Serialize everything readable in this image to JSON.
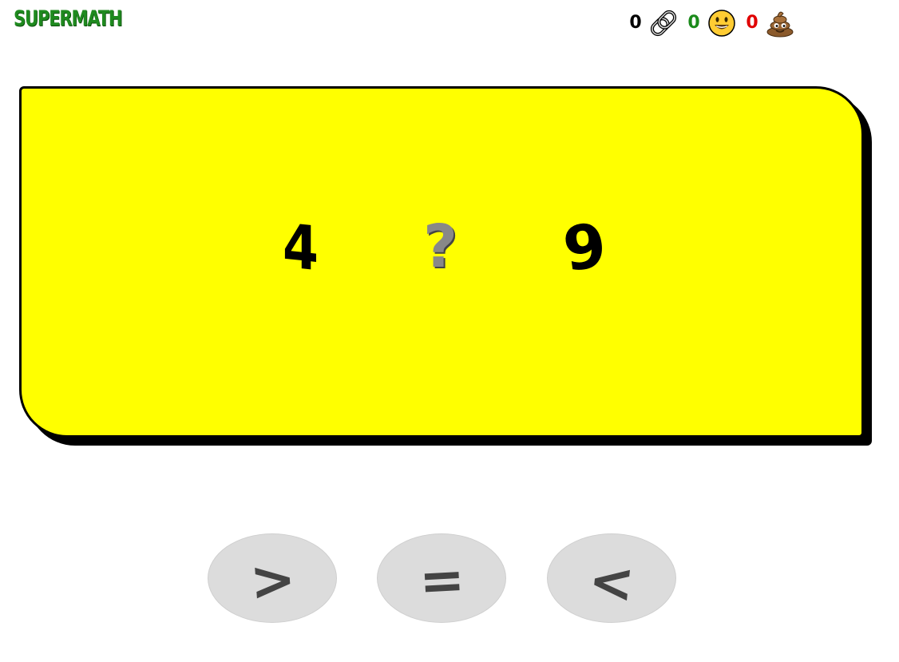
{
  "header": {
    "logo_text": "SUPERMATH"
  },
  "scoreboard": {
    "streak": {
      "value": "0",
      "icon": "chain-link-icon"
    },
    "correct": {
      "value": "0",
      "icon": "smiley-face-icon",
      "color": "#1a8a1a"
    },
    "wrong": {
      "value": "0",
      "icon": "poop-icon",
      "color": "#e00000"
    }
  },
  "puzzle": {
    "left_number": "4",
    "operator_placeholder": "?",
    "right_number": "9",
    "card_color": "#ffff00"
  },
  "choices": [
    {
      "label": ">"
    },
    {
      "label": "="
    },
    {
      "label": "<"
    }
  ]
}
